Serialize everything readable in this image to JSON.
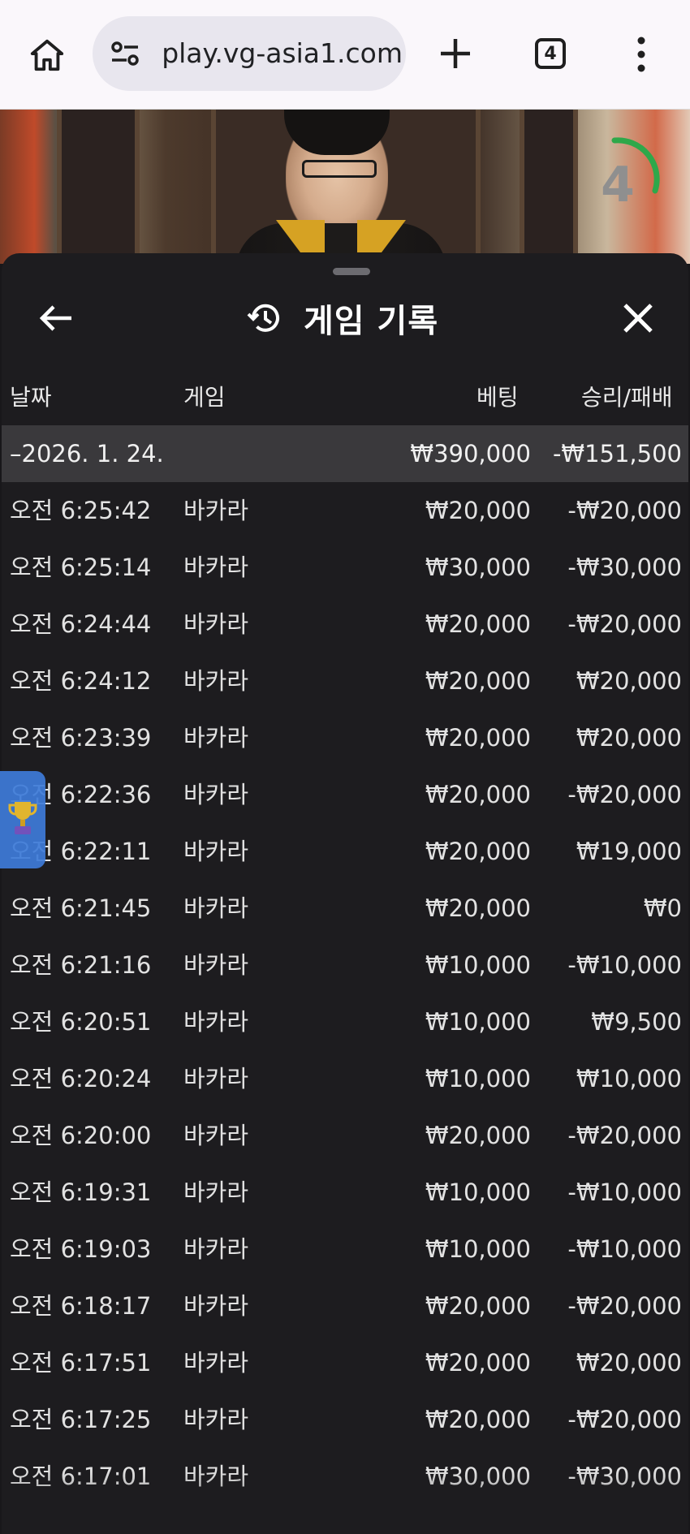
{
  "browser": {
    "url": "play.vg-asia1.com",
    "tab_count": "4"
  },
  "video": {
    "timer": "4"
  },
  "panel": {
    "title": "게임 기록",
    "columns": {
      "date": "날짜",
      "game": "게임",
      "bet": "베팅",
      "result": "승리/패배"
    },
    "summary": {
      "date": "–2026. 1. 24.",
      "bet": "₩390,000",
      "result": "-₩151,500"
    },
    "rows": [
      {
        "time": "오전 6:25:42",
        "game": "바카라",
        "bet": "₩20,000",
        "result": "-₩20,000"
      },
      {
        "time": "오전 6:25:14",
        "game": "바카라",
        "bet": "₩30,000",
        "result": "-₩30,000"
      },
      {
        "time": "오전 6:24:44",
        "game": "바카라",
        "bet": "₩20,000",
        "result": "-₩20,000"
      },
      {
        "time": "오전 6:24:12",
        "game": "바카라",
        "bet": "₩20,000",
        "result": "₩20,000"
      },
      {
        "time": "오전 6:23:39",
        "game": "바카라",
        "bet": "₩20,000",
        "result": "₩20,000"
      },
      {
        "time": "오전 6:22:36",
        "game": "바카라",
        "bet": "₩20,000",
        "result": "-₩20,000"
      },
      {
        "time": "오전 6:22:11",
        "game": "바카라",
        "bet": "₩20,000",
        "result": "₩19,000"
      },
      {
        "time": "오전 6:21:45",
        "game": "바카라",
        "bet": "₩20,000",
        "result": "₩0"
      },
      {
        "time": "오전 6:21:16",
        "game": "바카라",
        "bet": "₩10,000",
        "result": "-₩10,000"
      },
      {
        "time": "오전 6:20:51",
        "game": "바카라",
        "bet": "₩10,000",
        "result": "₩9,500"
      },
      {
        "time": "오전 6:20:24",
        "game": "바카라",
        "bet": "₩10,000",
        "result": "₩10,000"
      },
      {
        "time": "오전 6:20:00",
        "game": "바카라",
        "bet": "₩20,000",
        "result": "-₩20,000"
      },
      {
        "time": "오전 6:19:31",
        "game": "바카라",
        "bet": "₩10,000",
        "result": "-₩10,000"
      },
      {
        "time": "오전 6:19:03",
        "game": "바카라",
        "bet": "₩10,000",
        "result": "-₩10,000"
      },
      {
        "time": "오전 6:18:17",
        "game": "바카라",
        "bet": "₩20,000",
        "result": "-₩20,000"
      },
      {
        "time": "오전 6:17:51",
        "game": "바카라",
        "bet": "₩20,000",
        "result": "₩20,000"
      },
      {
        "time": "오전 6:17:25",
        "game": "바카라",
        "bet": "₩20,000",
        "result": "-₩20,000"
      },
      {
        "time": "오전 6:17:01",
        "game": "바카라",
        "bet": "₩30,000",
        "result": "-₩30,000"
      }
    ]
  },
  "icons": {
    "home": "home-icon",
    "site_settings": "tune-icon",
    "new_tab": "plus-icon",
    "tabs": "tab-switcher-icon",
    "menu": "more-vert-icon",
    "back": "arrow-left-icon",
    "history": "history-icon",
    "close": "close-icon",
    "trophy": "trophy-icon"
  },
  "colors": {
    "panel_bg": "#1d1c1f",
    "summary_bg": "#3a393c",
    "timer_ring": "#2ea84a",
    "trophy_tab": "#3e7bd9"
  }
}
